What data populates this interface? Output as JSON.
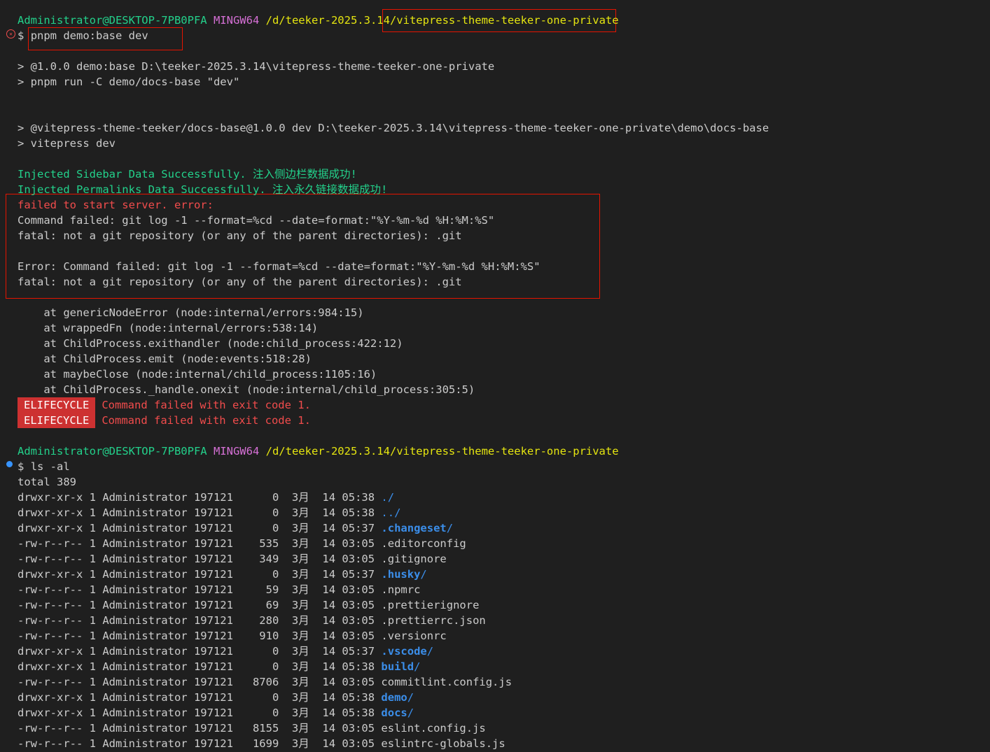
{
  "prompt1": {
    "user": "Administrator@DESKTOP-7PB0PFA",
    "system": "MINGW64",
    "path_prefix": "/d/teeker-2025.3.14/",
    "path_repo": "vitepress-theme-teeker-one-private"
  },
  "cmd1": {
    "symbol": "$",
    "text": "pnpm demo:base dev"
  },
  "run": [
    "> @1.0.0 demo:base D:\\teeker-2025.3.14\\vitepress-theme-teeker-one-private",
    "> pnpm run -C demo/docs-base \"dev\"",
    "> @vitepress-theme-teeker/docs-base@1.0.0 dev D:\\teeker-2025.3.14\\vitepress-theme-teeker-one-private\\demo\\docs-base",
    "> vitepress dev"
  ],
  "injected": [
    "Injected Sidebar Data Successfully. 注入侧边栏数据成功!",
    "Injected Permalinks Data Successfully. 注入永久链接数据成功!"
  ],
  "error_heading": "failed to start server. error:",
  "error_lines": [
    "Command failed: git log -1 --format=%cd --date=format:\"%Y-%m-%d %H:%M:%S\"",
    "fatal: not a git repository (or any of the parent directories): .git",
    "Error: Command failed: git log -1 --format=%cd --date=format:\"%Y-%m-%d %H:%M:%S\"",
    "fatal: not a git repository (or any of the parent directories): .git"
  ],
  "stack": [
    "    at genericNodeError (node:internal/errors:984:15)",
    "    at wrappedFn (node:internal/errors:538:14)",
    "    at ChildProcess.exithandler (node:child_process:422:12)",
    "    at ChildProcess.emit (node:events:518:28)",
    "    at maybeClose (node:internal/child_process:1105:16)",
    "    at ChildProcess._handle.onexit (node:internal/child_process:305:5)"
  ],
  "lifecycle": {
    "badge": "ELIFECYCLE",
    "message": "Command failed with exit code 1."
  },
  "prompt2": {
    "user": "Administrator@DESKTOP-7PB0PFA",
    "system": "MINGW64",
    "path": "/d/teeker-2025.3.14/vitepress-theme-teeker-one-private"
  },
  "cmd2": {
    "symbol": "$",
    "text": "ls -al"
  },
  "total": "total 389",
  "listing": [
    {
      "info": "drwxr-xr-x 1 Administrator 197121      0  3月  14 05:38 ",
      "name": ".",
      "suffix": "/",
      "kind": "dir"
    },
    {
      "info": "drwxr-xr-x 1 Administrator 197121      0  3月  14 05:38 ",
      "name": "..",
      "suffix": "/",
      "kind": "dir"
    },
    {
      "info": "drwxr-xr-x 1 Administrator 197121      0  3月  14 05:37 ",
      "name": ".changeset",
      "suffix": "/",
      "kind": "dirb"
    },
    {
      "info": "-rw-r--r-- 1 Administrator 197121    535  3月  14 03:05 ",
      "name": ".editorconfig",
      "suffix": "",
      "kind": "file"
    },
    {
      "info": "-rw-r--r-- 1 Administrator 197121    349  3月  14 03:05 ",
      "name": ".gitignore",
      "suffix": "",
      "kind": "file"
    },
    {
      "info": "drwxr-xr-x 1 Administrator 197121      0  3月  14 05:37 ",
      "name": ".husky",
      "suffix": "/",
      "kind": "dirb"
    },
    {
      "info": "-rw-r--r-- 1 Administrator 197121     59  3月  14 03:05 ",
      "name": ".npmrc",
      "suffix": "",
      "kind": "file"
    },
    {
      "info": "-rw-r--r-- 1 Administrator 197121     69  3月  14 03:05 ",
      "name": ".prettierignore",
      "suffix": "",
      "kind": "file"
    },
    {
      "info": "-rw-r--r-- 1 Administrator 197121    280  3月  14 03:05 ",
      "name": ".prettierrc.json",
      "suffix": "",
      "kind": "file"
    },
    {
      "info": "-rw-r--r-- 1 Administrator 197121    910  3月  14 03:05 ",
      "name": ".versionrc",
      "suffix": "",
      "kind": "file"
    },
    {
      "info": "drwxr-xr-x 1 Administrator 197121      0  3月  14 05:37 ",
      "name": ".vscode",
      "suffix": "/",
      "kind": "dirb"
    },
    {
      "info": "drwxr-xr-x 1 Administrator 197121      0  3月  14 05:38 ",
      "name": "build",
      "suffix": "/",
      "kind": "dirb"
    },
    {
      "info": "-rw-r--r-- 1 Administrator 197121   8706  3月  14 03:05 ",
      "name": "commitlint.config.js",
      "suffix": "",
      "kind": "file"
    },
    {
      "info": "drwxr-xr-x 1 Administrator 197121      0  3月  14 05:38 ",
      "name": "demo",
      "suffix": "/",
      "kind": "dirb"
    },
    {
      "info": "drwxr-xr-x 1 Administrator 197121      0  3月  14 05:38 ",
      "name": "docs",
      "suffix": "/",
      "kind": "dirb"
    },
    {
      "info": "-rw-r--r-- 1 Administrator 197121   8155  3月  14 03:05 ",
      "name": "eslint.config.js",
      "suffix": "",
      "kind": "file"
    },
    {
      "info": "-rw-r--r-- 1 Administrator 197121   1699  3月  14 03:05 ",
      "name": "eslintrc-globals.js",
      "suffix": "",
      "kind": "file"
    }
  ],
  "colors": {
    "background": "#1f1f1f",
    "foreground": "#cccccc",
    "prompt_user": "#23d18b",
    "prompt_system": "#d670d6",
    "prompt_path": "#e5e510",
    "error": "#f14c4c",
    "directory": "#3b8eea",
    "highlight_box": "#e51400",
    "badge": "#cd3131"
  },
  "icons": {
    "failed_command": "circle-x-icon",
    "ok_command": "circle-dot-icon"
  }
}
